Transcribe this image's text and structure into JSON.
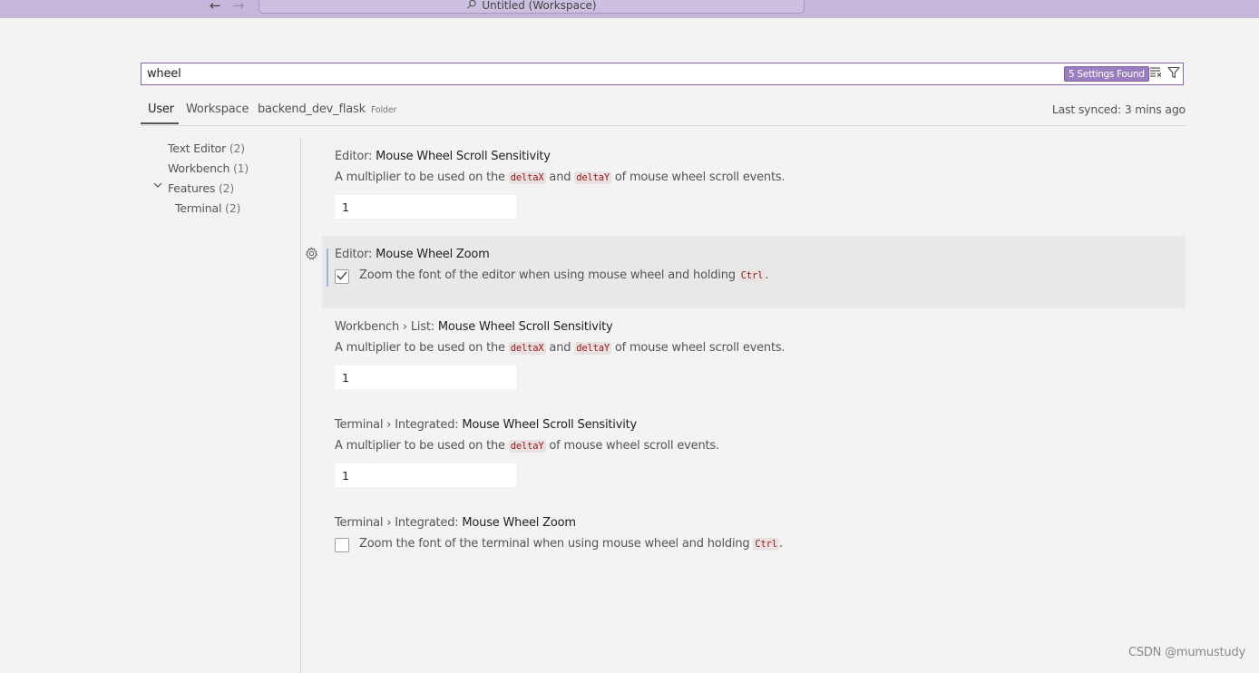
{
  "titlebar": {
    "back_arrow": "←",
    "forward_arrow": "→",
    "title": "Untitled (Workspace)",
    "title_icon": "search-icon"
  },
  "search": {
    "value": "wheel",
    "count": "5 Settings Found",
    "clear_icon": "clear-filter-icon",
    "filter_icon": "filter-icon"
  },
  "tabs": {
    "user": "User",
    "workspace": "Workspace",
    "folder": "backend_dev_flask",
    "folder_badge": "Folder",
    "synced": "Last synced: 3 mins ago"
  },
  "toc": [
    {
      "label": "Text Editor",
      "count": "(2)"
    },
    {
      "label": "Workbench",
      "count": "(1)"
    },
    {
      "label": "Features",
      "count": "(2)"
    },
    {
      "label": "Terminal",
      "count": "(2)"
    }
  ],
  "settings": [
    {
      "category": "Editor: ",
      "name": "Mouse Wheel Scroll Sensitivity",
      "desc_pre": "A multiplier to be used on the ",
      "code1": "deltaX",
      "desc_mid": " and ",
      "code2": "deltaY",
      "desc_post": " of mouse wheel scroll events.",
      "value": "1"
    },
    {
      "category": "Editor: ",
      "name": "Mouse Wheel Zoom",
      "label_pre": "Zoom the font of the editor when using mouse wheel and holding ",
      "code": "Ctrl",
      "label_post": ".",
      "checked": true
    },
    {
      "category": "Workbench › List: ",
      "name": "Mouse Wheel Scroll Sensitivity",
      "desc_pre": "A multiplier to be used on the ",
      "code1": "deltaX",
      "desc_mid": " and ",
      "code2": "deltaY",
      "desc_post": " of mouse wheel scroll events.",
      "value": "1"
    },
    {
      "category": "Terminal › Integrated: ",
      "name": "Mouse Wheel Scroll Sensitivity",
      "desc_pre": "A multiplier to be used on the ",
      "code1": "deltaY",
      "desc_post": " of mouse wheel scroll events.",
      "value": "1"
    },
    {
      "category": "Terminal › Integrated: ",
      "name": "Mouse Wheel Zoom",
      "label_pre": "Zoom the font of the terminal when using mouse wheel and holding ",
      "code": "Ctrl",
      "label_post": ".",
      "checked": false
    }
  ],
  "watermark": "CSDN @mumustudy",
  "colors": {
    "titlebar": "#c5b7d9",
    "search_border": "#8a62b8",
    "badge": "#9a7fc0",
    "code_text": "#a31515"
  }
}
